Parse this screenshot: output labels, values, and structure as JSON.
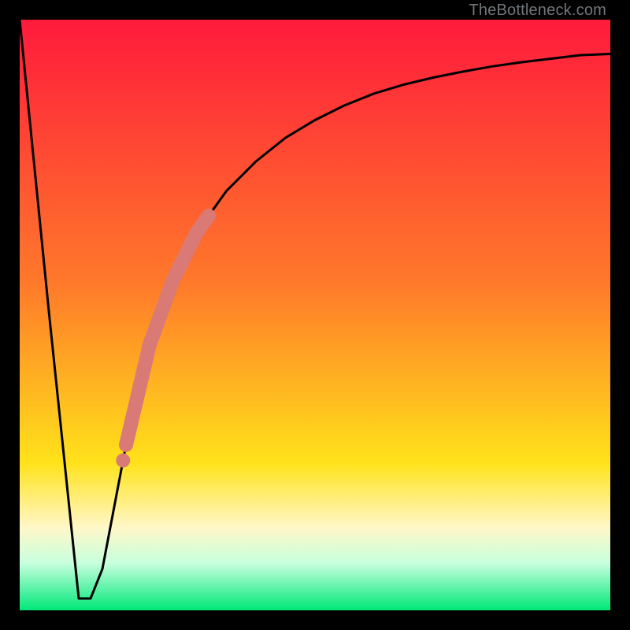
{
  "watermark": "TheBottleneck.com",
  "colors": {
    "top": "#ff1a3c",
    "mid1": "#ff7a2a",
    "mid2": "#ffe21a",
    "mid3": "#fff7c8",
    "mid4": "#c8ffde",
    "bottom": "#00e878",
    "curve": "#000000",
    "highlight": "#d97a76"
  },
  "chart_data": {
    "type": "line",
    "title": "",
    "xlabel": "",
    "ylabel": "",
    "xlim": [
      0,
      100
    ],
    "ylim": [
      0,
      100
    ],
    "series": [
      {
        "name": "bottleneck-curve",
        "x": [
          0,
          5,
          10,
          12,
          14,
          18,
          22,
          26,
          30,
          35,
          40,
          45,
          50,
          55,
          60,
          65,
          70,
          75,
          80,
          85,
          90,
          95,
          100
        ],
        "values": [
          100,
          50,
          2,
          2,
          7,
          28,
          45,
          56,
          64,
          71,
          76,
          80,
          83,
          85.5,
          87.5,
          89,
          90.2,
          91.2,
          92.1,
          92.8,
          93.4,
          94,
          94.2
        ]
      }
    ],
    "highlight_segment": {
      "description": "thick salmon overlay on curve",
      "x_start": 18,
      "x_end": 32,
      "markers_x": [
        17.5,
        19.5,
        21.5
      ],
      "marker_radius_pct": 1.2,
      "thick_stroke_pct": 2.4
    },
    "gradient_stops_pct": [
      {
        "offset": 0,
        "color_key": "top"
      },
      {
        "offset": 45,
        "color_key": "mid1"
      },
      {
        "offset": 75,
        "color_key": "mid2"
      },
      {
        "offset": 86,
        "color_key": "mid3"
      },
      {
        "offset": 92,
        "color_key": "mid4"
      },
      {
        "offset": 100,
        "color_key": "bottom"
      }
    ]
  }
}
